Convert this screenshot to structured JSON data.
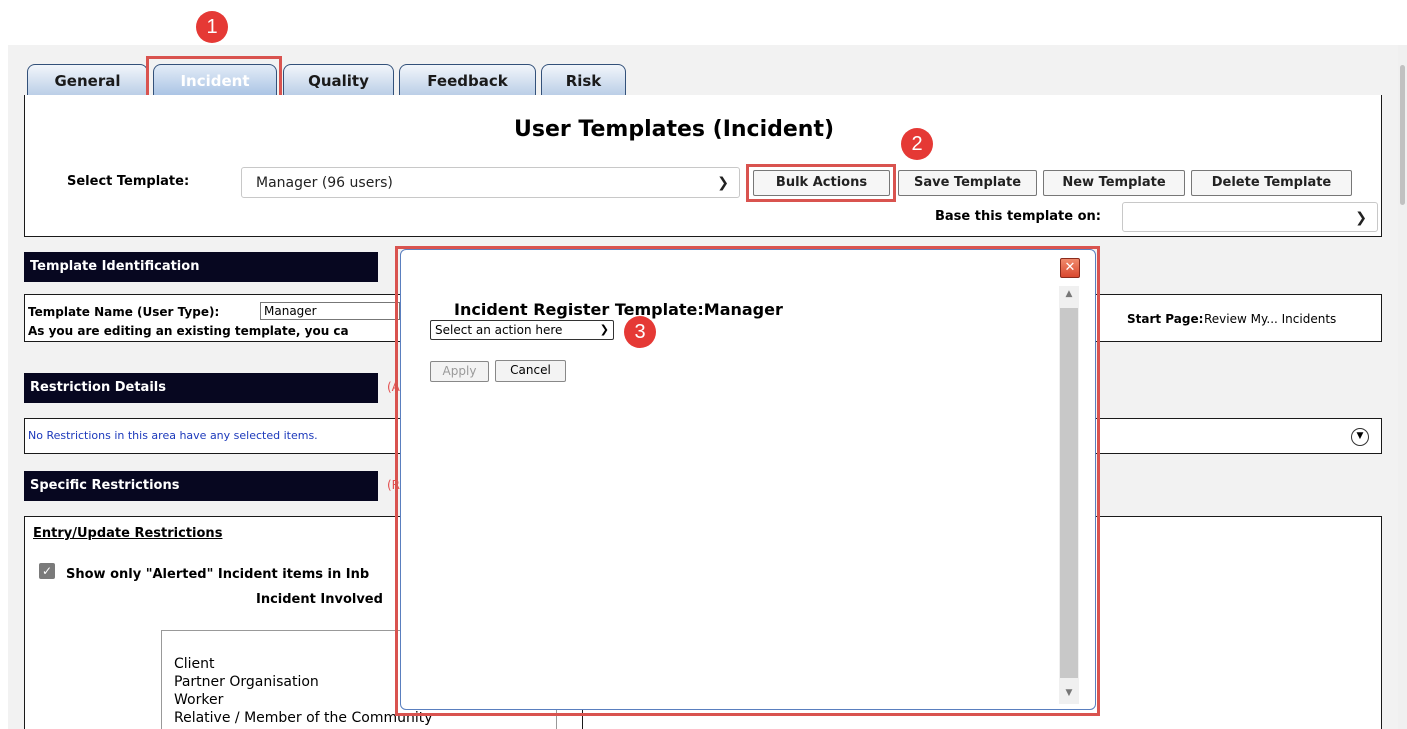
{
  "tabs": [
    {
      "label": "General"
    },
    {
      "label": "Incident"
    },
    {
      "label": "Quality"
    },
    {
      "label": "Feedback"
    },
    {
      "label": "Risk"
    }
  ],
  "markers": [
    "1",
    "2",
    "3"
  ],
  "header": {
    "title": "User Templates (Incident)",
    "select_template_label": "Select Template:",
    "select_template_value": "Manager (96 users)",
    "buttons": {
      "bulk_actions": "Bulk Actions",
      "save_template": "Save Template",
      "new_template": "New Template",
      "delete_template": "Delete Template"
    },
    "base_template_label": "Base this template on:",
    "base_template_value": ""
  },
  "template_identification": {
    "heading": "Template Identification",
    "name_label": "Template Name (User Type):",
    "name_value": "Manager",
    "editing_note": "As you are editing an existing template, you ca",
    "start_page_label": "Start Page:",
    "start_page_value": "Review My... Incidents"
  },
  "restriction_details": {
    "heading": "Restriction Details",
    "side_note": "(A",
    "message": "No Restrictions in this area have any selected items."
  },
  "specific_restrictions": {
    "heading": "Specific Restrictions",
    "side_note": "(R",
    "entry_update_heading": "Entry/Update Restrictions",
    "checkbox_label": "Show only \"Alerted\" Incident items in Inb",
    "involved_label": "Incident Involved",
    "list_items": [
      "Client",
      "Partner Organisation",
      "Worker",
      "Relative / Member of the Community"
    ]
  },
  "modal": {
    "title": "Incident Register Template:Manager",
    "action_select": "Select an action here",
    "apply": "Apply",
    "cancel": "Cancel",
    "close": "✕"
  },
  "colors": {
    "tab_border": "#33517a",
    "section_header_bg": "#070720",
    "marker_red": "#e53935",
    "highlight_red": "#d9534f",
    "link_blue": "#1c39bb"
  }
}
